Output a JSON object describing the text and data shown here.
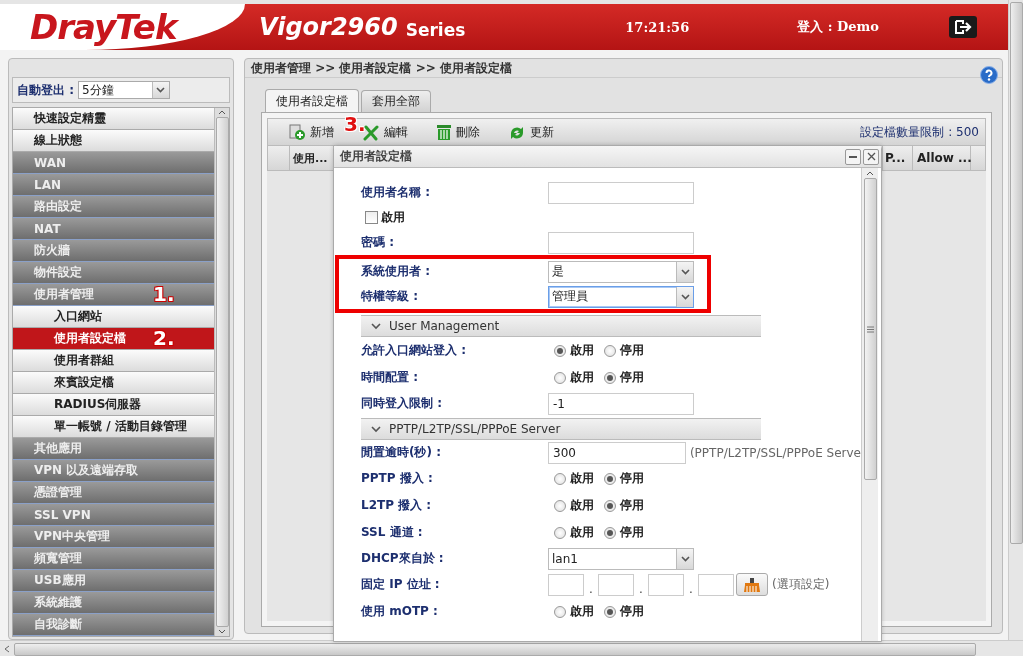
{
  "header": {
    "logo": "DrayTek",
    "product": "Vigor2960",
    "series": "Series",
    "time": "17:21:56",
    "login": "登入 : Demo"
  },
  "sidebar": {
    "auto_logout": {
      "label": "自動登出 :",
      "value": "5分鐘"
    },
    "menu": [
      {
        "label": "快速設定精靈",
        "kind": "top",
        "selected": false
      },
      {
        "label": "線上狀態",
        "kind": "top",
        "selected": false
      },
      {
        "label": "WAN",
        "kind": "group",
        "selected": false
      },
      {
        "label": "LAN",
        "kind": "group",
        "selected": false
      },
      {
        "label": "路由設定",
        "kind": "group",
        "selected": false
      },
      {
        "label": "NAT",
        "kind": "group",
        "selected": false
      },
      {
        "label": "防火牆",
        "kind": "group",
        "selected": false
      },
      {
        "label": "物件設定",
        "kind": "group",
        "selected": false
      },
      {
        "label": "使用者管理",
        "kind": "group",
        "selected": false,
        "marker": "1."
      },
      {
        "label": "入口網站",
        "kind": "sub",
        "selected": false
      },
      {
        "label": "使用者設定檔",
        "kind": "sub",
        "selected": true,
        "marker": "2."
      },
      {
        "label": "使用者群組",
        "kind": "sub",
        "selected": false
      },
      {
        "label": "來賓設定檔",
        "kind": "sub",
        "selected": false
      },
      {
        "label": "RADIUS伺服器",
        "kind": "sub",
        "selected": false
      },
      {
        "label": "單一帳號 / 活動目錄管理",
        "kind": "sub",
        "selected": false
      },
      {
        "label": "其他應用",
        "kind": "group",
        "selected": false
      },
      {
        "label": "VPN 以及遠端存取",
        "kind": "group",
        "selected": false
      },
      {
        "label": "憑證管理",
        "kind": "group",
        "selected": false
      },
      {
        "label": "SSL VPN",
        "kind": "group",
        "selected": false
      },
      {
        "label": "VPN中央管理",
        "kind": "group",
        "selected": false
      },
      {
        "label": "頻寬管理",
        "kind": "group",
        "selected": false
      },
      {
        "label": "USB應用",
        "kind": "group",
        "selected": false
      },
      {
        "label": "系統維護",
        "kind": "group",
        "selected": false
      },
      {
        "label": "自我診斷",
        "kind": "group",
        "selected": false
      }
    ]
  },
  "breadcrumb": "使用者管理 >> 使用者設定檔 >> 使用者設定檔",
  "tabs": [
    {
      "label": "使用者設定檔",
      "selected": true
    },
    {
      "label": "套用全部",
      "selected": false
    }
  ],
  "toolbar": {
    "buttons": [
      {
        "kind": "add",
        "label": "新增"
      },
      {
        "kind": "edit",
        "label": "編輯",
        "marker": "3."
      },
      {
        "kind": "delete",
        "label": "刪除"
      },
      {
        "kind": "refresh",
        "label": "更新"
      }
    ],
    "limit": "設定檔數量限制 : 500"
  },
  "table": {
    "columns": [
      {
        "label": "使用..."
      },
      {
        "label": "P..."
      },
      {
        "label": "Allow ..."
      }
    ]
  },
  "dialog": {
    "title": "使用者設定檔",
    "rows": [
      {
        "kind": "text",
        "label": "使用者名稱 :"
      },
      {
        "kind": "checkbox",
        "label": "啟用",
        "checked": false
      },
      {
        "kind": "text",
        "label": "密碼 :"
      },
      {
        "kind": "highlight",
        "rows": [
          {
            "kind": "select",
            "label": "系統使用者 :",
            "value": "是",
            "focused": false
          },
          {
            "kind": "select",
            "label": "特權等級 :",
            "value": "管理員",
            "focused": true
          }
        ]
      },
      {
        "kind": "section",
        "title": "User Management"
      },
      {
        "kind": "radio",
        "label": "允許入口網站登入 :",
        "options": [
          {
            "label": "啟用",
            "selected": true
          },
          {
            "label": "停用",
            "selected": false
          }
        ]
      },
      {
        "kind": "radio",
        "label": "時間配置 :",
        "options": [
          {
            "label": "啟用",
            "selected": false
          },
          {
            "label": "停用",
            "selected": true
          }
        ]
      },
      {
        "kind": "text",
        "label": "同時登入限制 :",
        "value": "-1"
      },
      {
        "kind": "section",
        "title": "PPTP/L2TP/SSL/PPPoE Server"
      },
      {
        "kind": "text",
        "label": "閒置逾時(秒) :",
        "value": "300",
        "note": "(PPTP/L2TP/SSL/PPPoE Serve"
      },
      {
        "kind": "radio",
        "label": "PPTP 撥入 :",
        "options": [
          {
            "label": "啟用",
            "selected": false
          },
          {
            "label": "停用",
            "selected": true
          }
        ]
      },
      {
        "kind": "radio",
        "label": "L2TP 撥入 :",
        "options": [
          {
            "label": "啟用",
            "selected": false
          },
          {
            "label": "停用",
            "selected": true
          }
        ]
      },
      {
        "kind": "radio",
        "label": "SSL 通道 :",
        "options": [
          {
            "label": "啟用",
            "selected": false
          },
          {
            "label": "停用",
            "selected": true
          }
        ]
      },
      {
        "kind": "select",
        "label": "DHCP來自於 :",
        "value": "lan1",
        "focused": false
      },
      {
        "kind": "ip",
        "label": "固定 IP 位址 :",
        "separators": [
          ".",
          ".",
          "."
        ],
        "note": "(選項設定)"
      },
      {
        "kind": "radio",
        "label": "使用 mOTP :",
        "options": [
          {
            "label": "啟用",
            "selected": false
          },
          {
            "label": "停用",
            "selected": true
          }
        ]
      }
    ]
  }
}
